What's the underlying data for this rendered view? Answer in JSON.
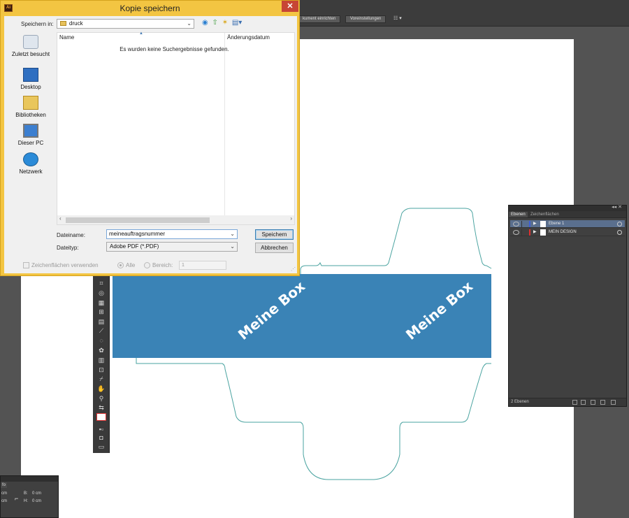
{
  "illustrator": {
    "toolbar_buttons": [
      "kument einrichten",
      "Voreinstellungen"
    ],
    "toolbar_extra": "☷ ▾"
  },
  "artwork": {
    "box_label_1": "Meine Box",
    "box_label_2": "Meine Box",
    "band_color": "#3a83b6",
    "outline_color": "#4aa3a0"
  },
  "layers_panel": {
    "tabs": [
      "Ebenen",
      "Zeichenflächen"
    ],
    "collapse": "◂◂ ✕",
    "rows": [
      {
        "name": "Ebene 1",
        "color": "#3e5fd6",
        "selected": true
      },
      {
        "name": "MEIN DESIGN",
        "color": "#e03030",
        "selected": false
      }
    ],
    "footer_count": "2 Ebenen"
  },
  "info_panel": {
    "tab": "fo",
    "values": [
      "cm",
      "cm",
      "B:",
      "0 cm",
      "H:",
      "0 cm"
    ]
  },
  "dialog": {
    "title": "Kopie speichern",
    "app_icon": "Ai",
    "close": "✕",
    "save_in_label": "Speichern in:",
    "save_in_value": "druck",
    "places": [
      "Zuletzt besucht",
      "Desktop",
      "Bibliotheken",
      "Dieser PC",
      "Netzwerk"
    ],
    "columns": [
      "Name",
      "Änderungsdatum"
    ],
    "empty_message": "Es wurden keine Suchergebnisse gefunden.",
    "filename_label": "Dateiname:",
    "filename_value": "meineauftragsnummer",
    "filetype_label": "Dateityp:",
    "filetype_value": "Adobe PDF (*.PDF)",
    "save_button": "Speichern",
    "cancel_button": "Abbrechen",
    "artboards_checkbox": "Zeichenflächen verwenden",
    "radio_all": "Alle",
    "radio_range": "Bereich:",
    "range_value": "1"
  }
}
